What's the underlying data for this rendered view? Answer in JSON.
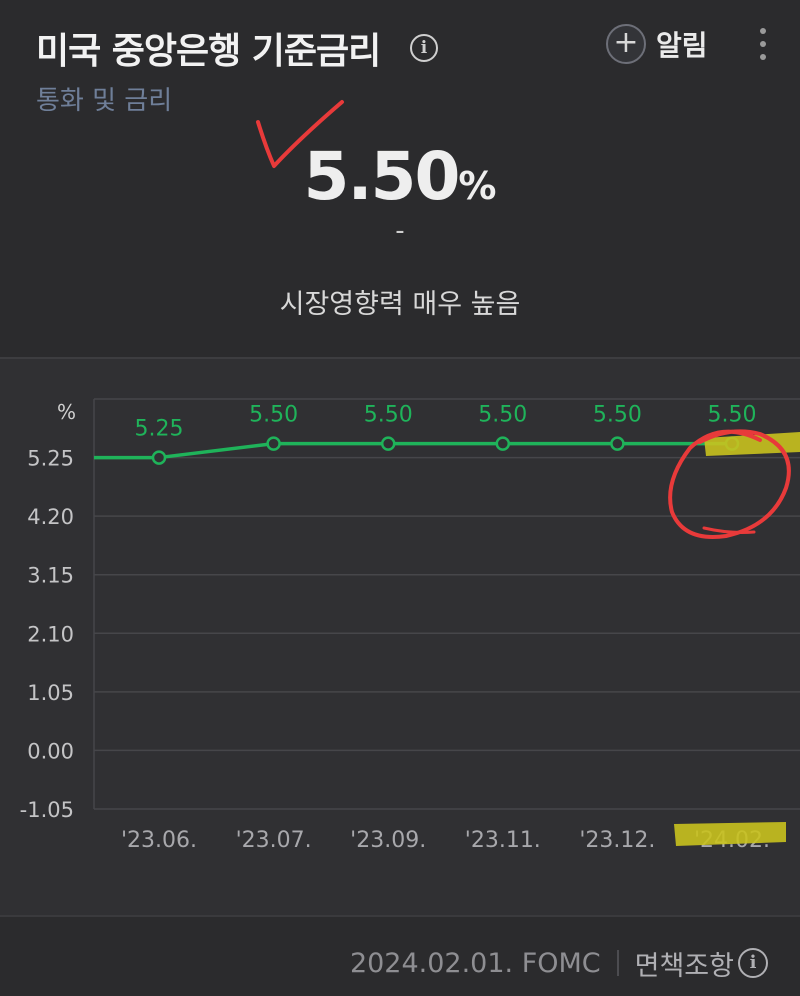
{
  "header": {
    "title": "미국 중앙은행 기준금리",
    "info_icon": "info-icon",
    "subtitle": "통화 및 금리",
    "alert_label": "알림",
    "alert_icon": "plus-icon",
    "more_icon": "more-vertical-icon"
  },
  "summary": {
    "value": "5.50",
    "unit": "%",
    "change": "-",
    "impact": "시장영향력 매우 높음"
  },
  "chart_data": {
    "type": "line",
    "ylabel": "%",
    "yticks": [
      "5.25",
      "4.20",
      "3.15",
      "2.10",
      "1.05",
      "0.00",
      "-1.05"
    ],
    "ylim": [
      -1.05,
      6.3
    ],
    "categories": [
      "'23.06.",
      "'23.07.",
      "'23.09.",
      "'23.11.",
      "'23.12.",
      "'24.02."
    ],
    "values": [
      5.25,
      5.5,
      5.5,
      5.5,
      5.5,
      5.5
    ],
    "value_labels": [
      "5.25",
      "5.50",
      "5.50",
      "5.50",
      "5.50",
      "5.50"
    ],
    "line_color": "#1fb35a",
    "grid": true
  },
  "footer": {
    "date_source": "2024.02.01. FOMC",
    "disclaimer": "면책조항"
  },
  "colors": {
    "background": "#2b2b2d",
    "chart_panel": "#303033",
    "accent_green": "#1fb35a",
    "annotation_red": "#e83a3a",
    "annotation_highlight": "#c9c21e"
  }
}
